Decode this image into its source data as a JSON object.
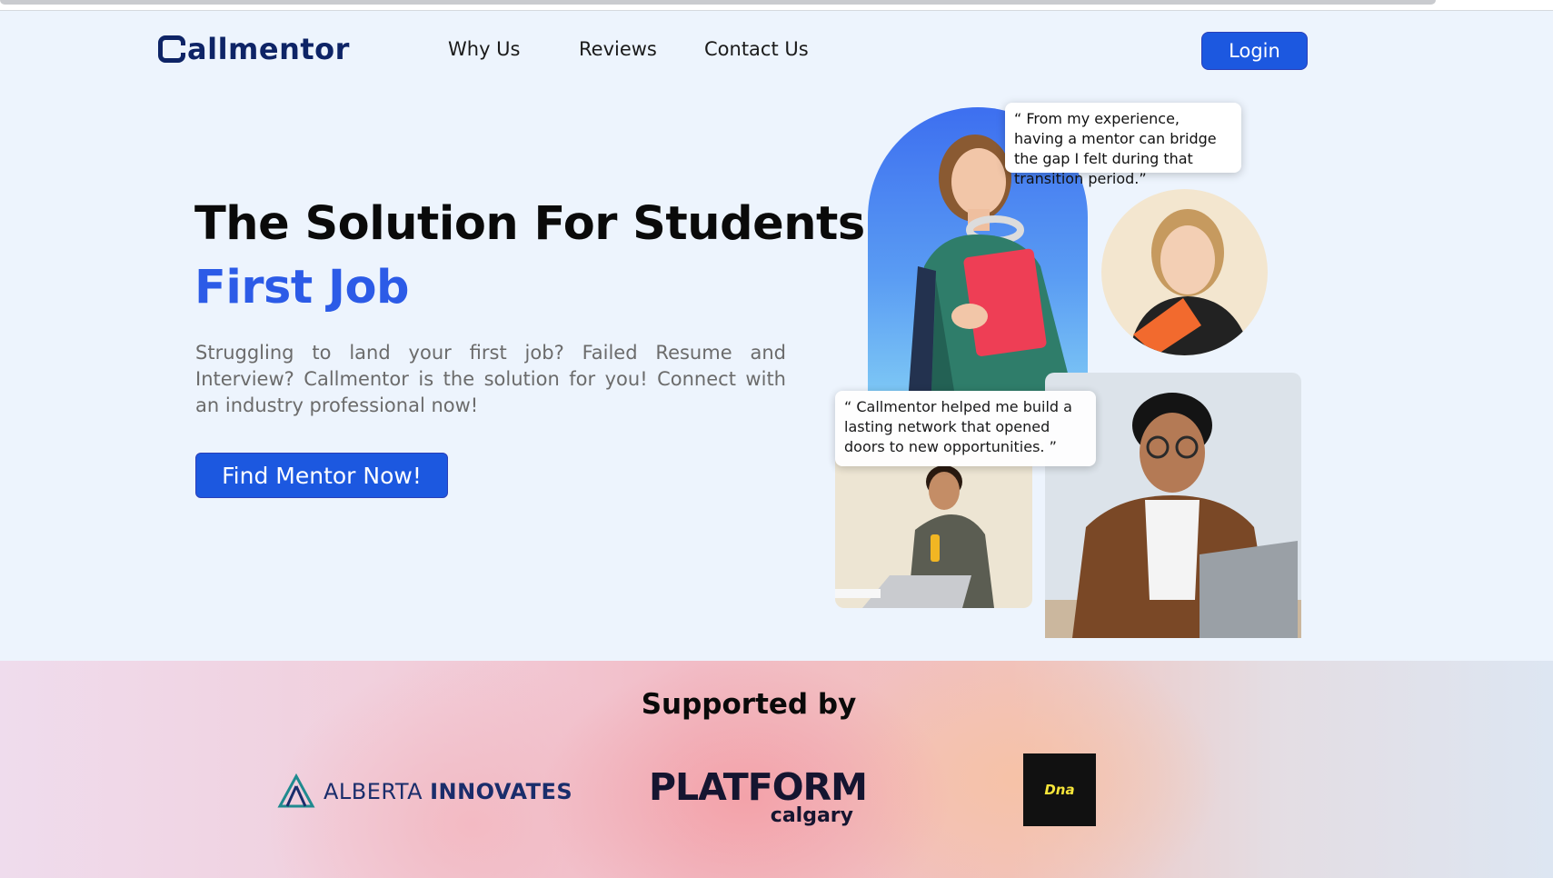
{
  "nav": {
    "logo_text": "allmentor",
    "links": [
      "Why Us",
      "Reviews",
      "Contact Us"
    ],
    "login_label": "Login"
  },
  "hero": {
    "title_line1": "The Solution For Students’",
    "title_line2": "First Job",
    "description": "Struggling to land your first job? Failed Resume and Interview? Callmentor is the solution for you! Connect with an industry professional now!",
    "cta_label": "Find Mentor Now!"
  },
  "testimonials": [
    "“ From my experience, having a mentor can bridge the gap I felt during that transition period.”",
    "“ Callmentor helped me build a lasting network that opened doors to new opportunities. ”"
  ],
  "supported": {
    "title": "Supported by",
    "sponsors": {
      "alberta_light": "ALBERTA",
      "alberta_bold": "INNOVATES",
      "platform_big": "PLATFORM",
      "platform_small": "calgary",
      "dna": "Dna"
    }
  },
  "colors": {
    "brand_blue": "#1c58e0",
    "accent_blue_text": "#2c5be7",
    "logo_navy": "#0e2466",
    "page_bg": "#edf4fd"
  }
}
